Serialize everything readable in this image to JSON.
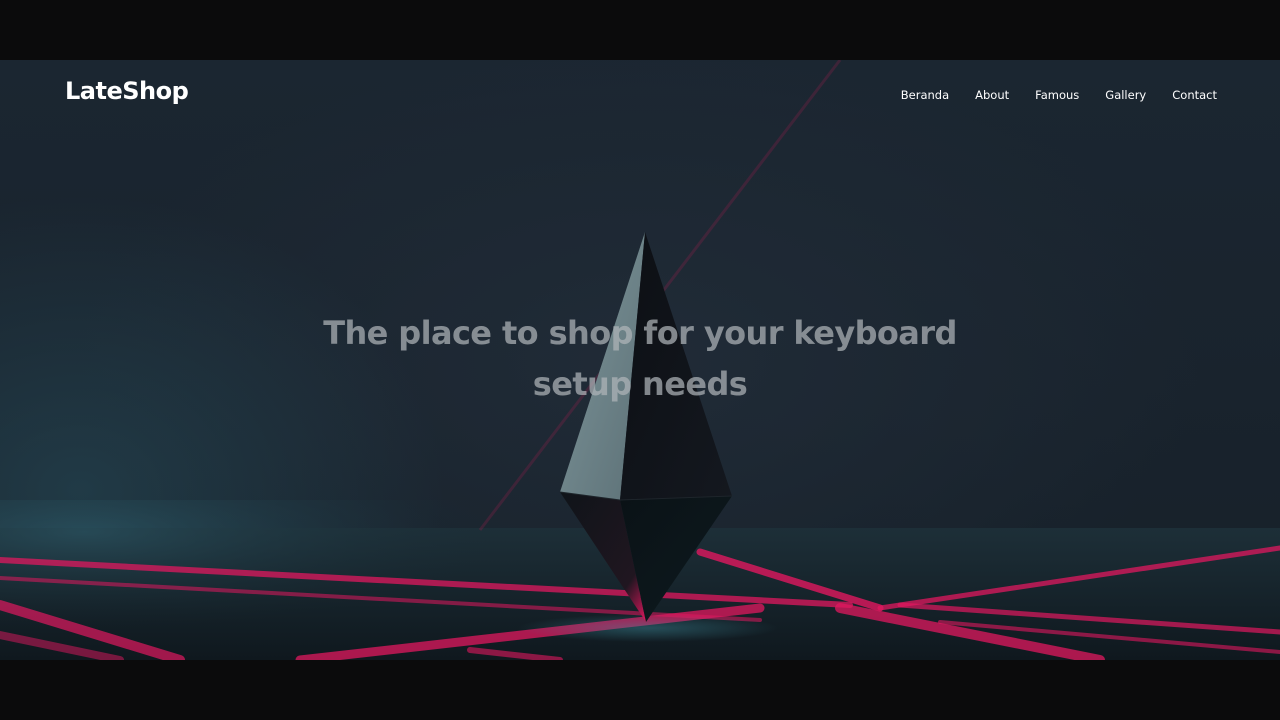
{
  "site": {
    "logo": "LateShop"
  },
  "nav": {
    "items": [
      {
        "label": "Beranda"
      },
      {
        "label": "About"
      },
      {
        "label": "Famous"
      },
      {
        "label": "Gallery"
      },
      {
        "label": "Contact"
      }
    ]
  },
  "hero": {
    "headline": "The place to shop for your keyboard setup needs",
    "image": "dark-crystal-with-pink-light-beams"
  },
  "colors": {
    "background": "#0b0b0c",
    "hero_dark": "#19232d",
    "accent_pink": "#e0185f",
    "text_white": "#ffffff",
    "headline_grey": "#afb4b9"
  }
}
